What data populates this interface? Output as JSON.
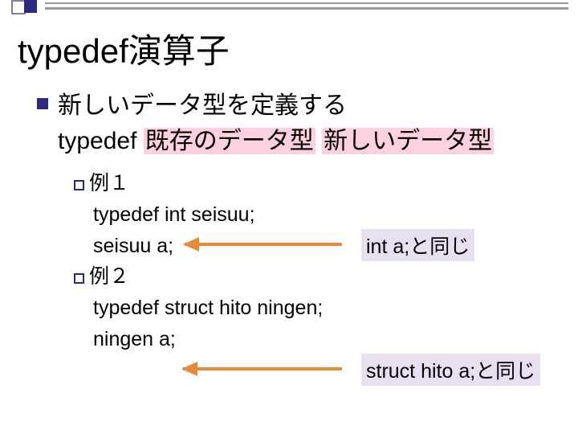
{
  "title": "typedef演算子",
  "l1": {
    "line1": "新しいデータ型を定義する",
    "line2_prefix": "typedef ",
    "line2_pink1": "既存のデータ型",
    "line2_sep": " ",
    "line2_pink2": "新しいデータ型"
  },
  "ex1": {
    "label": "例１",
    "code1": "typedef int seisuu;",
    "code2": "seisuu a;",
    "note": "int a;と同じ"
  },
  "ex2": {
    "label": "例２",
    "code1": "typedef struct hito ningen;",
    "code2": "ningen a;",
    "note": "struct hito a;と同じ"
  }
}
